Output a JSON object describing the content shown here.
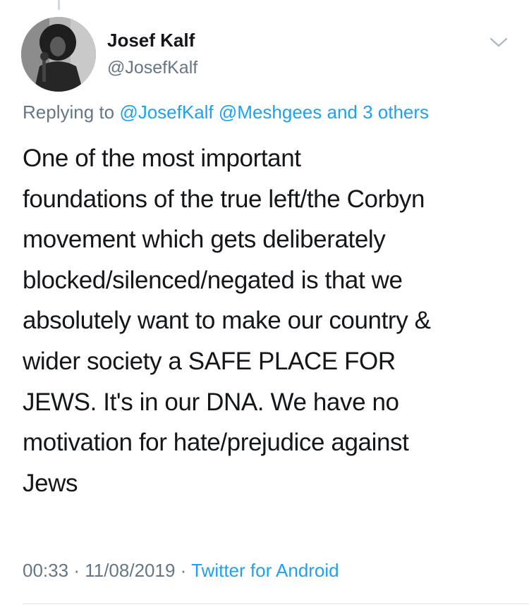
{
  "author": {
    "display_name": "Josef Kalf",
    "handle": "@JosefKalf"
  },
  "reply": {
    "prefix": "Replying to",
    "mentions": [
      "@JosefKalf",
      "@Meshgees"
    ],
    "others": "and 3 others"
  },
  "tweet": {
    "lines": [
      "One of the most important",
      "foundations of the true left/the Corbyn",
      "movement which gets deliberately",
      "blocked/silenced/negated is that we",
      "absolutely want to make our country &",
      "wider society a SAFE PLACE FOR",
      "JEWS. It's in our DNA. We have no",
      "motivation for hate/prejudice against",
      "Jews"
    ]
  },
  "meta": {
    "time": "00:33",
    "separator": "·",
    "date": "11/08/2019",
    "source": "Twitter for Android"
  },
  "colors": {
    "text": "#14171a",
    "secondary": "#657786",
    "link": "#1da1f2"
  },
  "icons": {
    "menu": "chevron-down-icon"
  }
}
